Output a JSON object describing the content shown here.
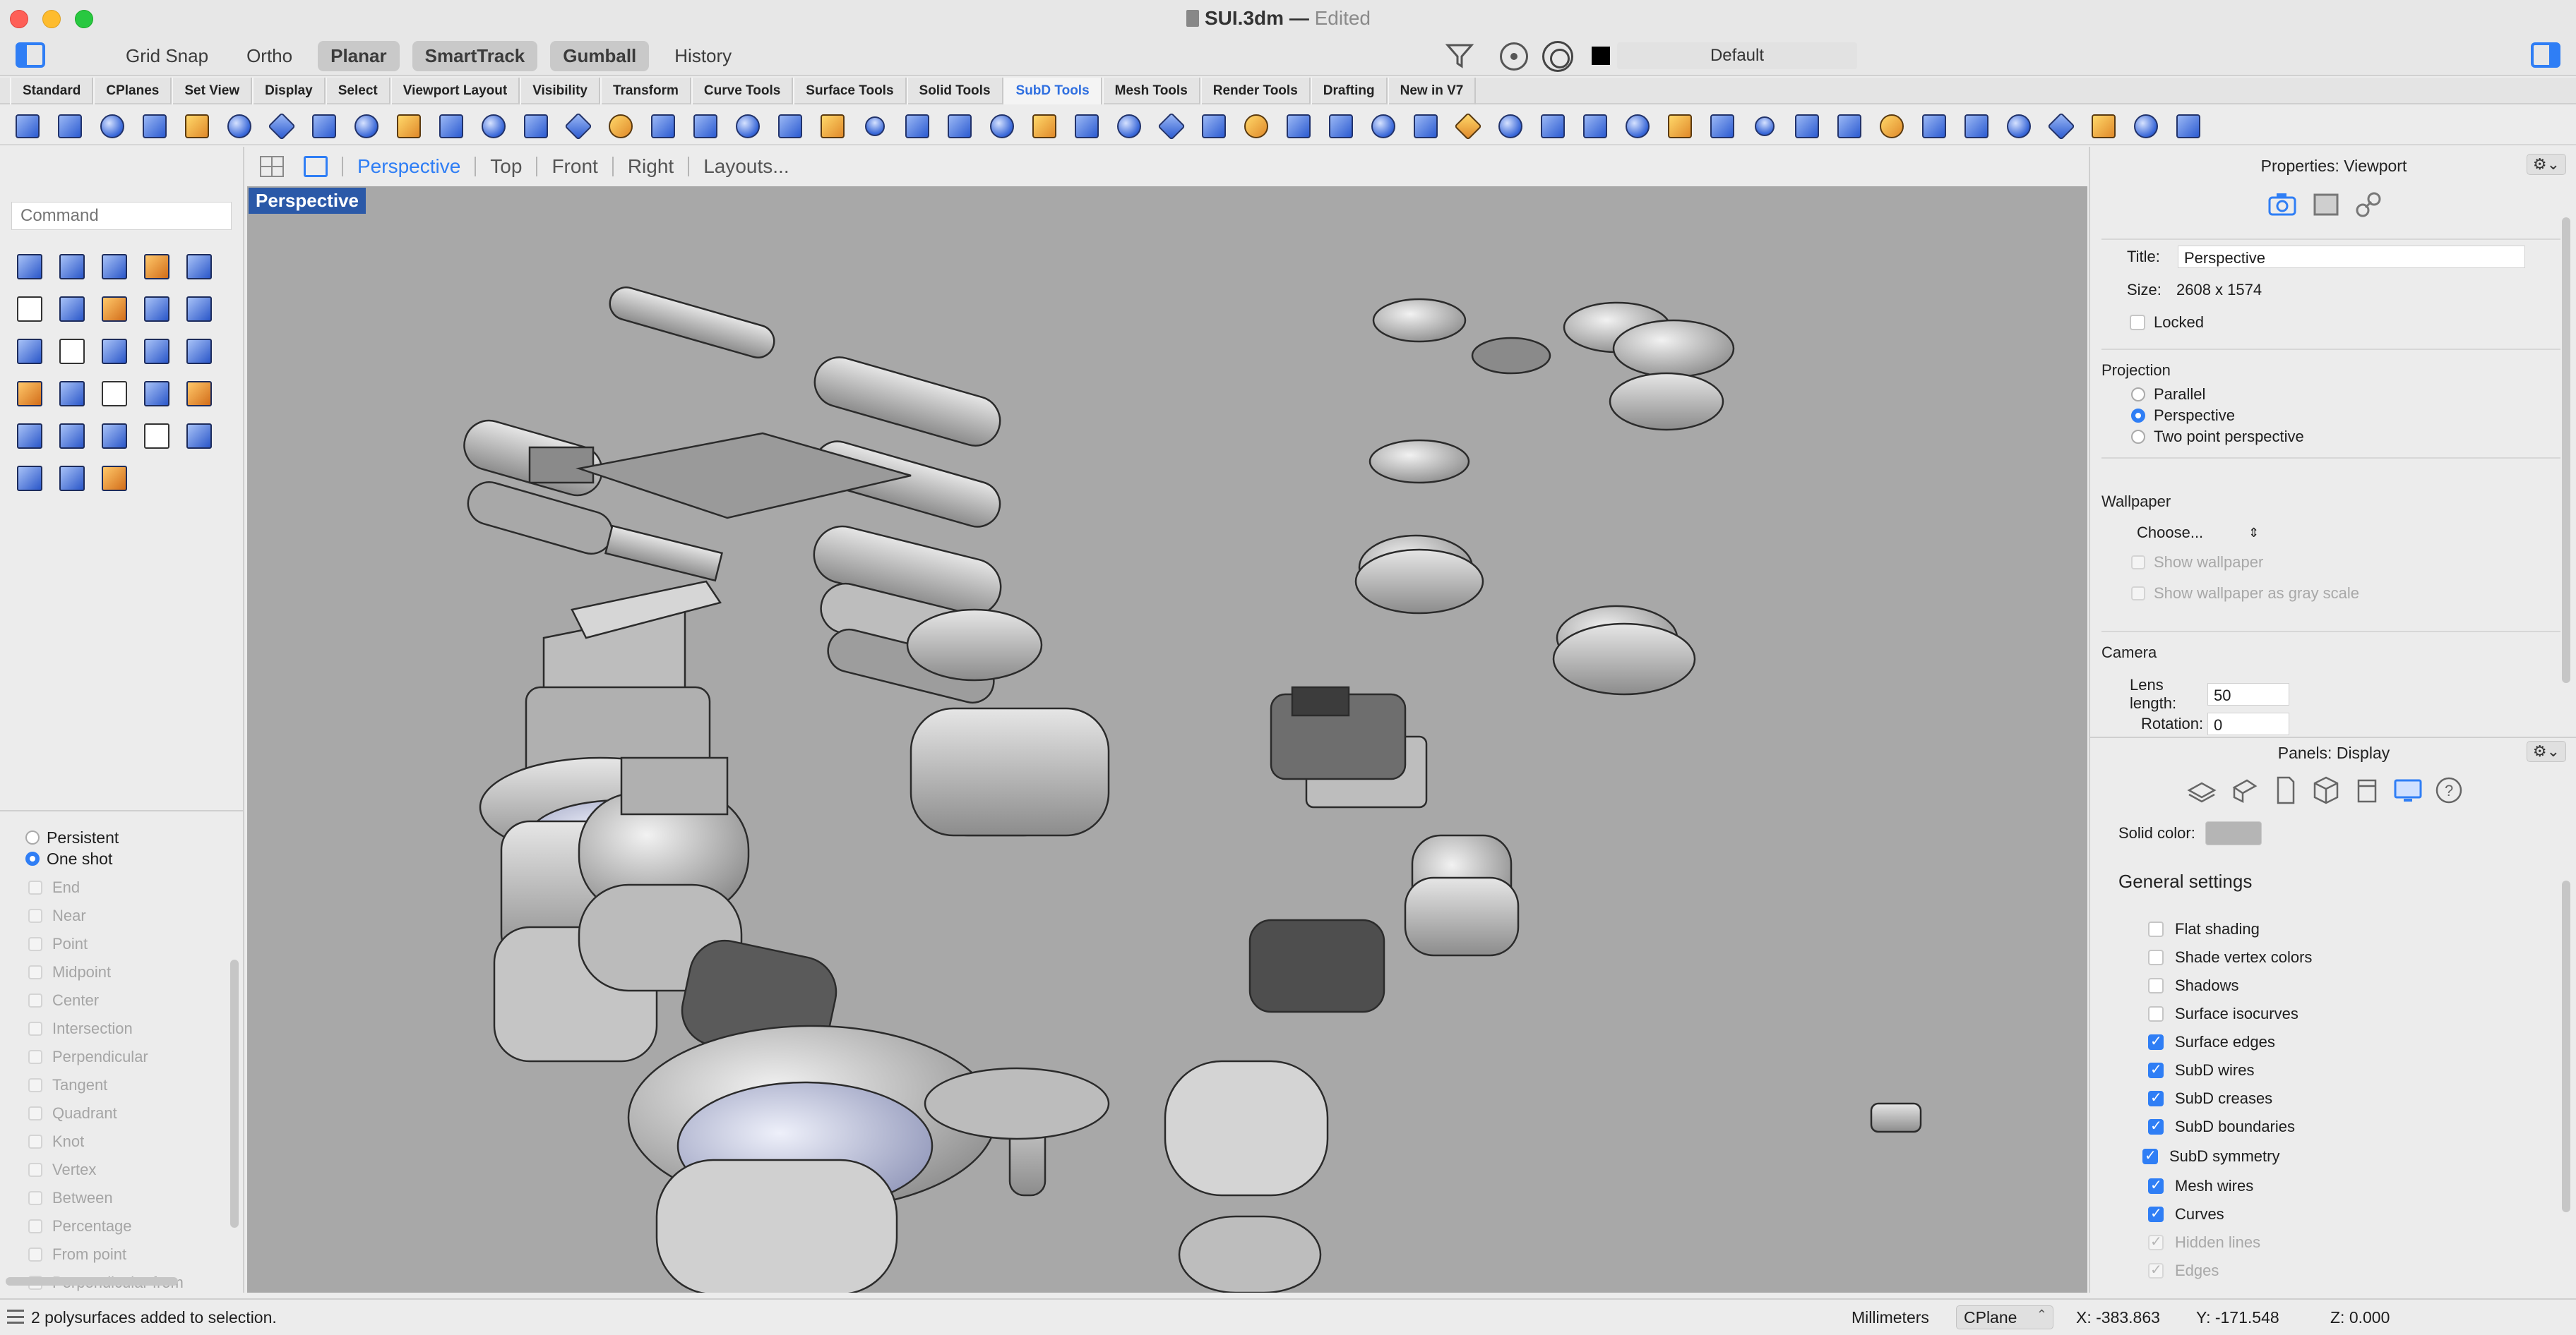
{
  "window": {
    "title": "SUI.3dm",
    "separator": "—",
    "edited": "Edited",
    "layer": "Default"
  },
  "modes": [
    {
      "label": "Grid Snap",
      "on": false
    },
    {
      "label": "Ortho",
      "on": false
    },
    {
      "label": "Planar",
      "on": true
    },
    {
      "label": "SmartTrack",
      "on": true
    },
    {
      "label": "Gumball",
      "on": true
    },
    {
      "label": "History",
      "on": false
    }
  ],
  "tabs": [
    "Standard",
    "CPlanes",
    "Set View",
    "Display",
    "Select",
    "Viewport Layout",
    "Visibility",
    "Transform",
    "Curve Tools",
    "Surface Tools",
    "Solid Tools",
    "SubD Tools",
    "Mesh Tools",
    "Render Tools",
    "Drafting",
    "New in V7"
  ],
  "active_tab": "SubD Tools",
  "command": {
    "placeholder": "Command"
  },
  "snap": {
    "persistent": "Persistent",
    "one_shot": "One shot",
    "options": [
      "End",
      "Near",
      "Point",
      "Midpoint",
      "Center",
      "Intersection",
      "Perpendicular",
      "Tangent",
      "Quadrant",
      "Knot",
      "Vertex",
      "Between",
      "Percentage",
      "From point",
      "Perpendicular from"
    ]
  },
  "viewport_tabs": [
    "Perspective",
    "Top",
    "Front",
    "Right",
    "Layouts..."
  ],
  "viewport_label": "Perspective",
  "properties": {
    "header": "Properties: Viewport",
    "title_label": "Title:",
    "title_value": "Perspective",
    "size_label": "Size:",
    "size_value": "2608 x 1574",
    "locked": "Locked",
    "projection": "Projection",
    "proj_parallel": "Parallel",
    "proj_perspective": "Perspective",
    "proj_two_point": "Two point perspective",
    "wallpaper": "Wallpaper",
    "choose": "Choose...",
    "show_wallpaper": "Show wallpaper",
    "show_gray": "Show wallpaper as gray scale",
    "camera": "Camera",
    "lens_label": "Lens length:",
    "lens_value": "50",
    "rotation_label": "Rotation:",
    "rotation_value": "0"
  },
  "display_panel": {
    "header": "Panels: Display",
    "solid_color_label": "Solid color:",
    "solid_color": "#b5b5b5",
    "general_settings": "General settings",
    "checks": [
      {
        "label": "Flat shading",
        "on": false
      },
      {
        "label": "Shade vertex colors",
        "on": false
      },
      {
        "label": "Shadows",
        "on": false
      },
      {
        "label": "Surface isocurves",
        "on": false
      },
      {
        "label": "Surface edges",
        "on": true
      },
      {
        "label": "SubD wires",
        "on": true
      },
      {
        "label": "SubD creases",
        "on": true
      },
      {
        "label": "SubD boundaries",
        "on": true
      },
      {
        "label": "SubD symmetry",
        "on": true
      },
      {
        "label": "Mesh wires",
        "on": true
      },
      {
        "label": "Curves",
        "on": true
      },
      {
        "label": "Hidden lines",
        "on": true,
        "dim": true
      },
      {
        "label": "Edges",
        "on": true,
        "dim": true
      }
    ]
  },
  "status": {
    "message": "2 polysurfaces added to selection.",
    "units": "Millimeters",
    "cplane": "CPlane",
    "x": "X: -383.863",
    "y": "Y: -171.548",
    "z": "Z: 0.000"
  },
  "colors": {
    "accent": "#2f7ef5",
    "viewport_bg": "#a8a8a8",
    "viewport_label_bg": "#2b59a8"
  }
}
